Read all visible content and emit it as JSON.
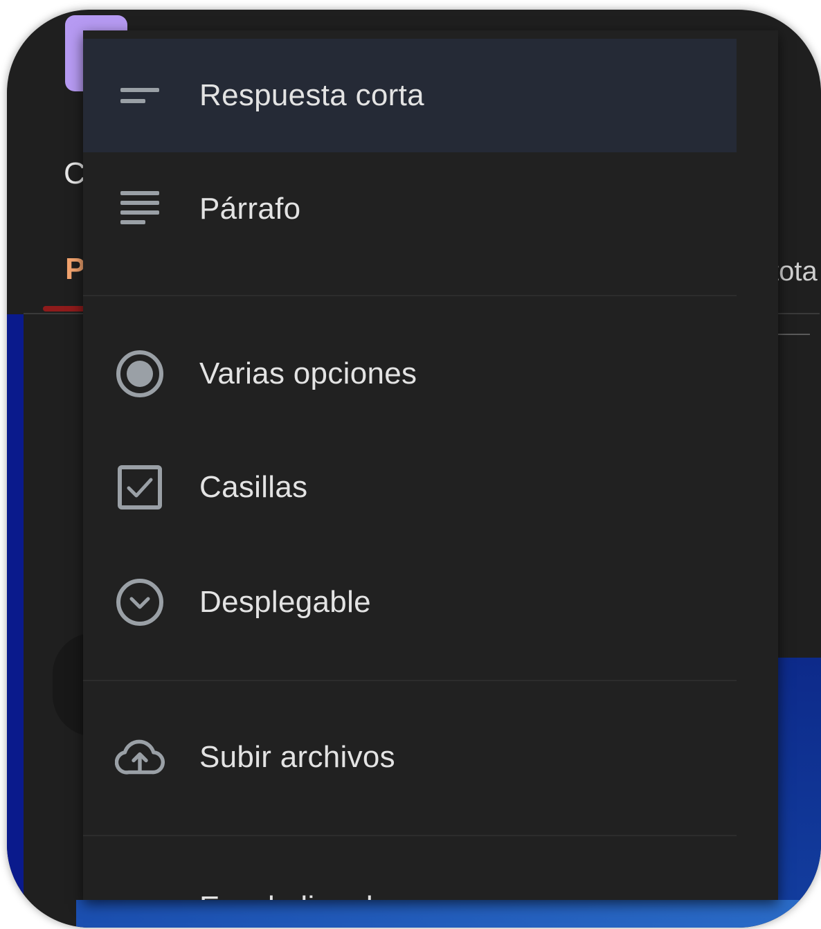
{
  "background": {
    "left_letter_1": "C",
    "left_letter_2": "P",
    "right_text": "tota"
  },
  "menu": {
    "items": [
      {
        "label": "Respuesta corta",
        "icon": "short-text-icon",
        "selected": true
      },
      {
        "label": "Párrafo",
        "icon": "paragraph-icon"
      },
      {
        "label": "Varias opciones",
        "icon": "radio-button-icon"
      },
      {
        "label": "Casillas",
        "icon": "checkbox-icon"
      },
      {
        "label": "Desplegable",
        "icon": "dropdown-icon"
      },
      {
        "label": "Subir archivos",
        "icon": "cloud-upload-icon"
      },
      {
        "label": "Escala lineal",
        "icon": "linear-scale-icon"
      }
    ]
  },
  "colors": {
    "menu_background": "#212121",
    "selected_background": "#252a36",
    "text": "#e3e3e3",
    "icon": "#9aa0a6",
    "accent_tab": "#f2a36e"
  }
}
